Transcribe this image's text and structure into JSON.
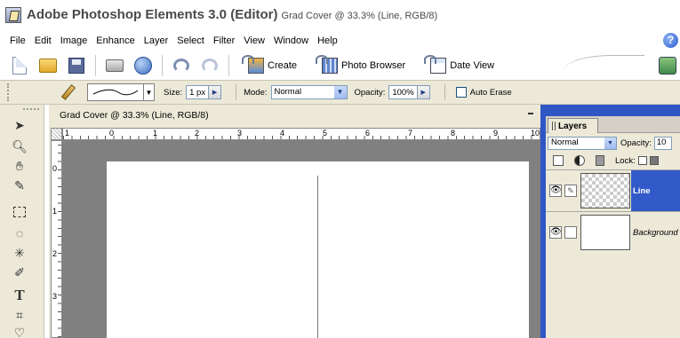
{
  "window": {
    "app_title": "Adobe Photoshop Elements 3.0 (Editor)",
    "doc_title": "Grad Cover @ 33.3% (Line, RGB/8)"
  },
  "menu": [
    "File",
    "Edit",
    "Image",
    "Enhance",
    "Layer",
    "Select",
    "Filter",
    "View",
    "Window",
    "Help"
  ],
  "shortcuts": {
    "create_label": "Create",
    "photo_browser_label": "Photo Browser",
    "date_view_label": "Date View"
  },
  "options": {
    "size_label": "Size:",
    "size_value": "1 px",
    "mode_label": "Mode:",
    "mode_value": "Normal",
    "opacity_label": "Opacity:",
    "opacity_value": "100%",
    "auto_erase_label": "Auto Erase",
    "auto_erase_checked": false
  },
  "document": {
    "title": "Grad Cover @ 33.3% (Line, RGB/8)",
    "ruler_top_numbers": [
      "1",
      "0",
      "1",
      "2",
      "3",
      "4",
      "5",
      "6",
      "7",
      "8",
      "9",
      "10"
    ],
    "ruler_left_numbers": [
      "0",
      "1",
      "2",
      "3"
    ]
  },
  "layers_panel": {
    "tab_label": "Layers",
    "blend_mode": "Normal",
    "opacity_label": "Opacity:",
    "opacity_value": "10",
    "lock_label": "Lock:",
    "layers": [
      {
        "name": "Line",
        "selected": true,
        "visible": true,
        "transparent": true
      },
      {
        "name": "Background",
        "selected": false,
        "visible": true,
        "transparent": false
      }
    ]
  },
  "colors": {
    "accent_blue": "#2f57c4",
    "selected_layer": "#3159c8",
    "panel_bg": "#ece9d8",
    "canvas_bg": "#808080"
  }
}
